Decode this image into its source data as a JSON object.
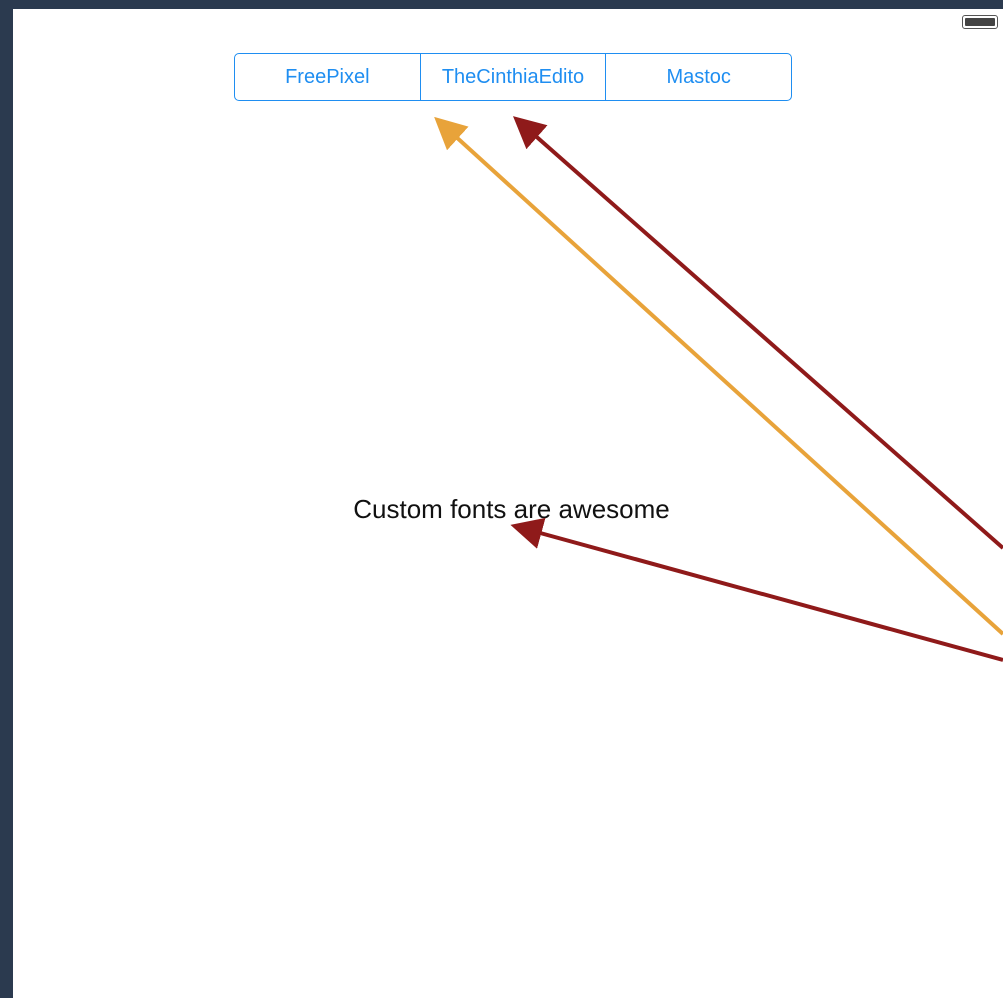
{
  "status_bar": {
    "battery_icon": "battery-icon"
  },
  "segmented_control": {
    "segments": [
      {
        "label": "FreePixel"
      },
      {
        "label": "TheCinthiaEdito"
      },
      {
        "label": "Mastoc"
      }
    ],
    "color": "#1f8ef1"
  },
  "main": {
    "label_text": "Custom fonts are awesome"
  },
  "annotations": {
    "arrow_colors": {
      "orange": "#e8a33a",
      "dark_red": "#8f1a1a"
    }
  }
}
